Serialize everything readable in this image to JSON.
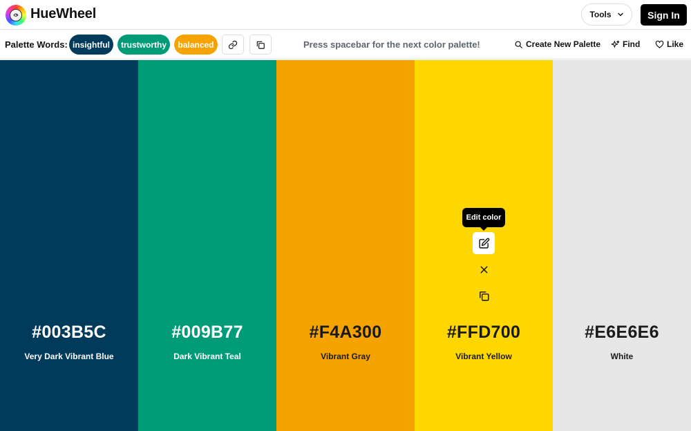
{
  "header": {
    "app_title": "HueWheel",
    "tools_label": "Tools",
    "signin_label": "Sign In"
  },
  "toolbar": {
    "palette_words_label": "Palette Words:",
    "words": [
      {
        "label": "insightful",
        "color": "#003B5C"
      },
      {
        "label": "trustworthy",
        "color": "#009B77"
      },
      {
        "label": "balanced",
        "color": "#F4A300"
      }
    ],
    "hint": "Press spacebar for the next color palette!",
    "create_label": "Create New Palette",
    "find_label": "Find",
    "like_label": "Like"
  },
  "palette": {
    "swatches": [
      {
        "hex": "#003B5C",
        "name": "Very Dark Vibrant Blue",
        "text_color": "#ffffff"
      },
      {
        "hex": "#009B77",
        "name": "Dark Vibrant Teal",
        "text_color": "#ffffff"
      },
      {
        "hex": "#F4A300",
        "name": "Vibrant Gray",
        "text_color": "#1a1a1a"
      },
      {
        "hex": "#FFD700",
        "name": "Vibrant Yellow",
        "text_color": "#1a1a1a"
      },
      {
        "hex": "#E6E6E6",
        "name": "White",
        "text_color": "#1a1a1a"
      }
    ],
    "tooltip": "Edit color"
  }
}
